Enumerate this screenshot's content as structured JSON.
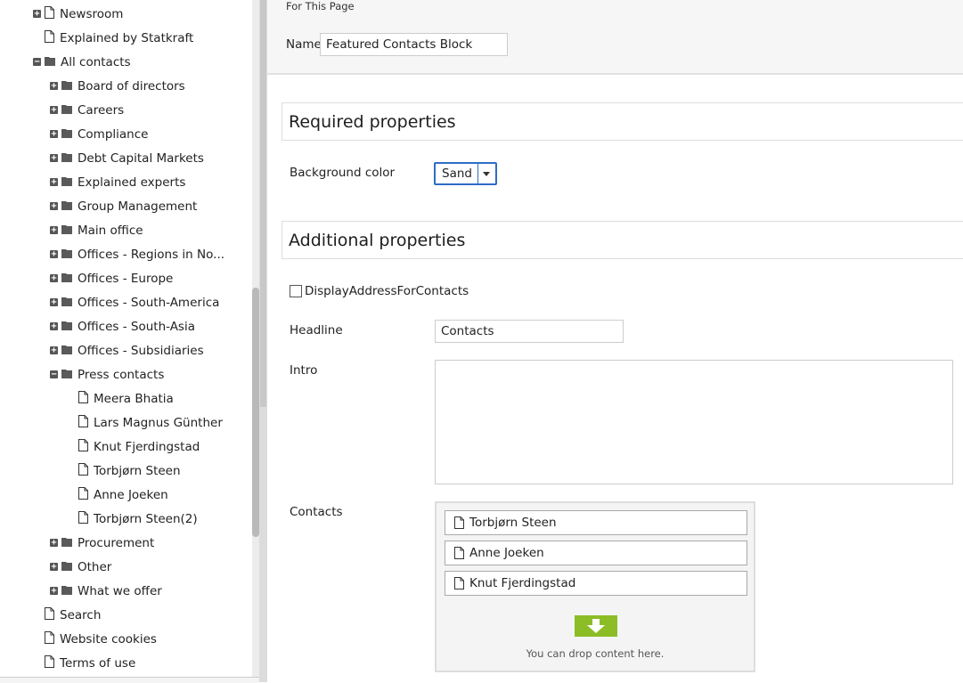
{
  "tree": {
    "items": [
      {
        "label": "Newsroom",
        "level": 1,
        "type": "page",
        "expander": "plus"
      },
      {
        "label": "Explained by Statkraft",
        "level": 1,
        "type": "page",
        "expander": ""
      },
      {
        "label": "All contacts",
        "level": 1,
        "type": "folder",
        "expander": "minus"
      },
      {
        "label": "Board of directors",
        "level": 2,
        "type": "folder",
        "expander": "plus"
      },
      {
        "label": "Careers",
        "level": 2,
        "type": "folder",
        "expander": "plus"
      },
      {
        "label": "Compliance",
        "level": 2,
        "type": "folder",
        "expander": "plus"
      },
      {
        "label": "Debt Capital Markets",
        "level": 2,
        "type": "folder",
        "expander": "plus"
      },
      {
        "label": "Explained experts",
        "level": 2,
        "type": "folder",
        "expander": "plus"
      },
      {
        "label": "Group Management",
        "level": 2,
        "type": "folder",
        "expander": "plus"
      },
      {
        "label": "Main office",
        "level": 2,
        "type": "folder",
        "expander": "plus"
      },
      {
        "label": "Offices - Regions in No...",
        "level": 2,
        "type": "folder",
        "expander": "plus"
      },
      {
        "label": "Offices - Europe",
        "level": 2,
        "type": "folder",
        "expander": "plus"
      },
      {
        "label": "Offices - South-America",
        "level": 2,
        "type": "folder",
        "expander": "plus"
      },
      {
        "label": "Offices - South-Asia",
        "level": 2,
        "type": "folder",
        "expander": "plus"
      },
      {
        "label": "Offices - Subsidiaries",
        "level": 2,
        "type": "folder",
        "expander": "plus"
      },
      {
        "label": "Press contacts",
        "level": 2,
        "type": "folder",
        "expander": "minus"
      },
      {
        "label": "Meera Bhatia",
        "level": 3,
        "type": "page",
        "expander": ""
      },
      {
        "label": "Lars Magnus Günther",
        "level": 3,
        "type": "page",
        "expander": ""
      },
      {
        "label": "Knut Fjerdingstad",
        "level": 3,
        "type": "page",
        "expander": ""
      },
      {
        "label": "Torbjørn Steen",
        "level": 3,
        "type": "page",
        "expander": ""
      },
      {
        "label": "Anne Joeken",
        "level": 3,
        "type": "page",
        "expander": ""
      },
      {
        "label": "Torbjørn Steen(2)",
        "level": 3,
        "type": "page",
        "expander": ""
      },
      {
        "label": "Procurement",
        "level": 2,
        "type": "folder",
        "expander": "plus"
      },
      {
        "label": "Other",
        "level": 2,
        "type": "folder",
        "expander": "plus"
      },
      {
        "label": "What we offer",
        "level": 2,
        "type": "folder",
        "expander": "plus"
      },
      {
        "label": "Search",
        "level": 1,
        "type": "page",
        "expander": ""
      },
      {
        "label": "Website cookies",
        "level": 1,
        "type": "page",
        "expander": ""
      },
      {
        "label": "Terms of use",
        "level": 1,
        "type": "page",
        "expander": ""
      }
    ]
  },
  "header": {
    "for_page": "For This Page",
    "name_label": "Name",
    "name_value": "Featured Contacts Block"
  },
  "required": {
    "title": "Required properties",
    "bg_label": "Background color",
    "bg_value": "Sand",
    "accent_color": "#2e6cc7"
  },
  "additional": {
    "title": "Additional properties",
    "checkbox_label": "DisplayAddressForContacts",
    "checkbox_checked": false,
    "headline_label": "Headline",
    "headline_value": "Contacts",
    "intro_label": "Intro",
    "intro_value": "",
    "contacts_label": "Contacts",
    "contacts": [
      "Torbjørn Steen",
      "Anne Joeken",
      "Knut Fjerdingstad"
    ],
    "drop_text": "You can drop content here.",
    "drop_color": "#8cbd26"
  }
}
